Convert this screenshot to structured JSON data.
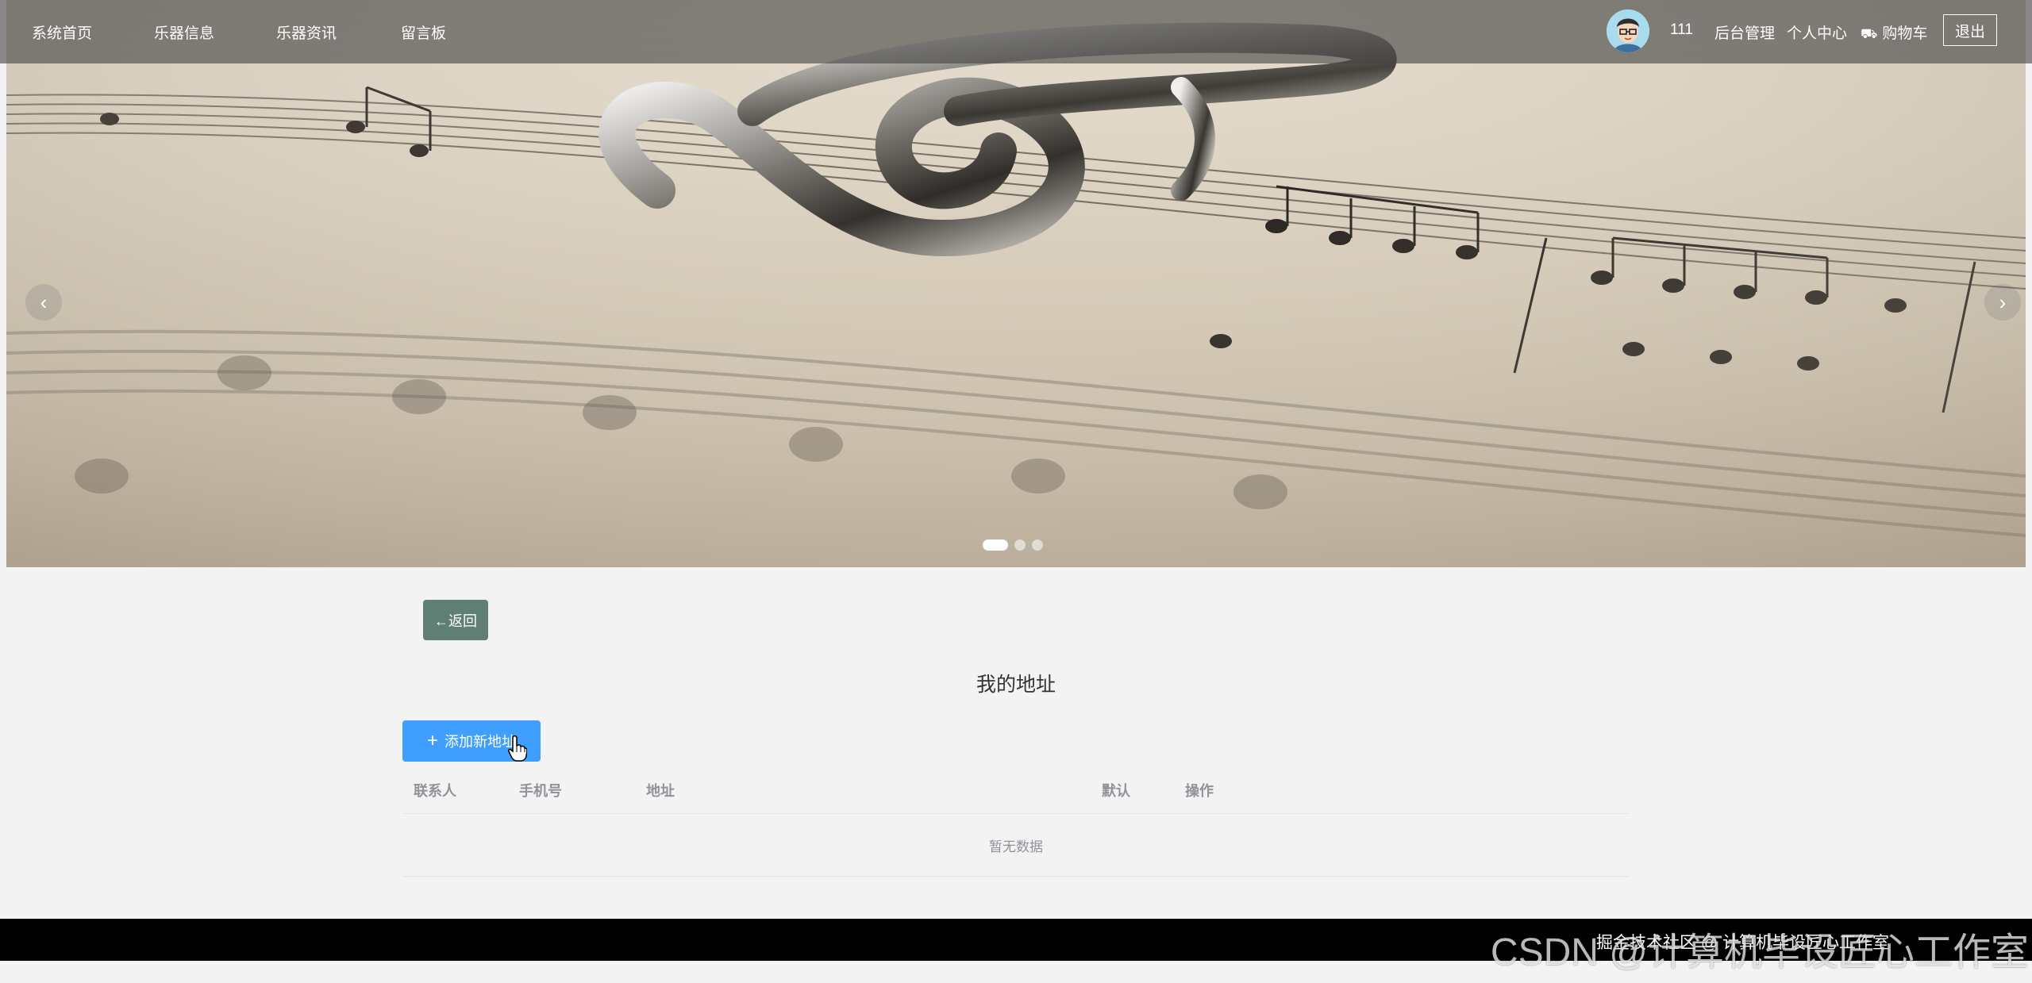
{
  "nav": {
    "items": [
      {
        "label": "系统首页"
      },
      {
        "label": "乐器信息"
      },
      {
        "label": "乐器资讯"
      },
      {
        "label": "留言板"
      }
    ],
    "username": "111",
    "admin_label": "后台管理",
    "profile_label": "个人中心",
    "cart_label": "购物车",
    "logout_label": "退出"
  },
  "carousel": {
    "prev_icon": "‹",
    "next_icon": "›",
    "slide_count": 3,
    "active_index": 0
  },
  "page": {
    "back_label": "←返回",
    "title": "我的地址",
    "add_label": "添加新地址",
    "add_icon": "+"
  },
  "table": {
    "headers": {
      "contact": "联系人",
      "phone": "手机号",
      "address": "地址",
      "default": "默认",
      "actions": "操作"
    },
    "empty_text": "暂无数据"
  },
  "footer": {
    "text": "掘金技术社区 @ 计算机毕设匠心工作室"
  },
  "watermark": "CSDN @计算机毕设匠心工作室",
  "colors": {
    "primary": "#409eff",
    "back_button": "#5f7f74",
    "footer": "#000000"
  }
}
